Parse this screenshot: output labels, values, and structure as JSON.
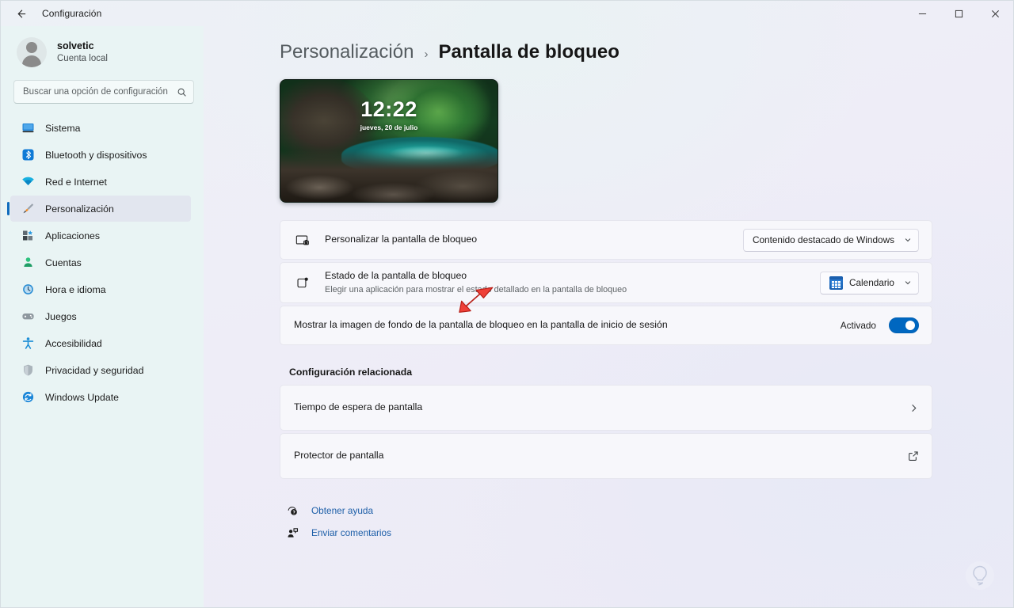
{
  "window": {
    "app_title": "Configuración",
    "back_icon": "arrow-left-icon",
    "controls": {
      "minimize": "minimize-icon",
      "maximize": "maximize-icon",
      "close": "close-icon"
    }
  },
  "sidebar": {
    "account": {
      "name": "solvetic",
      "subtitle": "Cuenta local",
      "avatar": "user-avatar"
    },
    "search": {
      "placeholder": "Buscar una opción de configuración",
      "icon": "search-icon"
    },
    "items": [
      {
        "label": "Sistema",
        "icon": "monitor-icon",
        "selected": false
      },
      {
        "label": "Bluetooth y dispositivos",
        "icon": "bluetooth-icon",
        "selected": false
      },
      {
        "label": "Red e Internet",
        "icon": "wifi-icon",
        "selected": false
      },
      {
        "label": "Personalización",
        "icon": "paintbrush-icon",
        "selected": true
      },
      {
        "label": "Aplicaciones",
        "icon": "apps-icon",
        "selected": false
      },
      {
        "label": "Cuentas",
        "icon": "account-icon",
        "selected": false
      },
      {
        "label": "Hora e idioma",
        "icon": "clock-icon",
        "selected": false
      },
      {
        "label": "Juegos",
        "icon": "gamepad-icon",
        "selected": false
      },
      {
        "label": "Accesibilidad",
        "icon": "accessibility-icon",
        "selected": false
      },
      {
        "label": "Privacidad y seguridad",
        "icon": "shield-icon",
        "selected": false
      },
      {
        "label": "Windows Update",
        "icon": "update-icon",
        "selected": false
      }
    ]
  },
  "breadcrumb": {
    "parent": "Personalización",
    "separator": "›",
    "current": "Pantalla de bloqueo"
  },
  "preview": {
    "time": "12:22",
    "date": "jueves, 20 de julio"
  },
  "settings_rows": [
    {
      "icon": "lockscreen-personalize-icon",
      "title": "Personalizar la pantalla de bloqueo",
      "subtitle": "",
      "control": "dropdown",
      "value": "Contenido destacado de Windows",
      "chevron": "chevron-down-icon"
    },
    {
      "icon": "lockscreen-status-icon",
      "title": "Estado de la pantalla de bloqueo",
      "subtitle": "Elegir una aplicación para mostrar el estado detallado en la pantalla de bloqueo",
      "control": "dropdown-with-app-icon",
      "value": "Calendario",
      "app_icon": "calendar-app-icon",
      "chevron": "chevron-down-icon"
    },
    {
      "icon": "",
      "title": "Mostrar la imagen de fondo de la pantalla de bloqueo en la pantalla de inicio de sesión",
      "subtitle": "",
      "control": "toggle",
      "value": "Activado",
      "toggle_on": true
    }
  ],
  "related": {
    "heading": "Configuración relacionada",
    "links": [
      {
        "label": "Tiempo de espera de pantalla",
        "trailing_icon": "chevron-right-icon"
      },
      {
        "label": "Protector de pantalla",
        "trailing_icon": "external-link-icon"
      }
    ]
  },
  "help": [
    {
      "label": "Obtener ayuda",
      "icon": "help-icon"
    },
    {
      "label": "Enviar comentarios",
      "icon": "feedback-icon"
    }
  ],
  "annotation": {
    "type": "red-arrow",
    "points_to": "Estado de la pantalla de bloqueo"
  },
  "watermark": {
    "icon": "lightbulb-watermark"
  },
  "colors": {
    "sidebar_bg": "#e9f4f4",
    "content_bg": "#eeeef7",
    "card_bg": "#f7f7fb",
    "accent": "#0067c0",
    "selected_indicator": "#0f6cbd",
    "link": "#1d5fa8",
    "annotation": "#e8382f"
  }
}
